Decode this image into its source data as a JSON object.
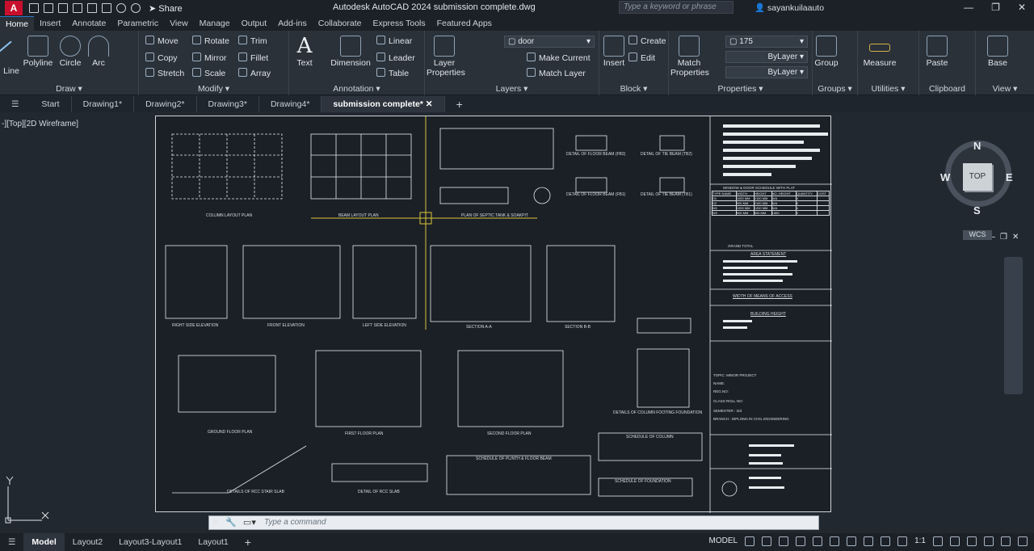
{
  "app": {
    "logo_letter": "A",
    "share_label": "Share",
    "window_title": "Autodesk AutoCAD 2024   submission complete.dwg",
    "search_placeholder": "Type a keyword or phrase",
    "user_name": "sayankuilaauto"
  },
  "ribbon_tabs": [
    "Home",
    "Insert",
    "Annotate",
    "Parametric",
    "View",
    "Manage",
    "Output",
    "Add-ins",
    "Collaborate",
    "Express Tools",
    "Featured Apps"
  ],
  "ribbon": {
    "draw": {
      "title": "Draw ▾",
      "line": "Line",
      "polyline": "Polyline",
      "circle": "Circle",
      "arc": "Arc"
    },
    "modify": {
      "title": "Modify ▾",
      "move": "Move",
      "rotate": "Rotate",
      "trim": "Trim",
      "copy": "Copy",
      "mirror": "Mirror",
      "fillet": "Fillet",
      "stretch": "Stretch",
      "scale": "Scale",
      "array": "Array"
    },
    "annotation": {
      "title": "Annotation ▾",
      "text": "Text",
      "dimension": "Dimension",
      "linear": "Linear",
      "leader": "Leader",
      "table": "Table"
    },
    "layers": {
      "title": "Layers ▾",
      "layer_properties": "Layer Properties",
      "current_layer": "door",
      "make_current": "Make Current",
      "match_layer": "Match Layer"
    },
    "block": {
      "title": "Block ▾",
      "insert": "Insert",
      "create": "Create",
      "edit": "Edit"
    },
    "properties": {
      "title": "Properties ▾",
      "match_properties": "Match Properties",
      "color": "175",
      "linetype": "ByLayer",
      "lineweight": "ByLayer"
    },
    "groups": {
      "title": "Groups ▾",
      "group": "Group"
    },
    "utilities": {
      "title": "Utilities ▾",
      "measure": "Measure"
    },
    "clipboard": {
      "title": "Clipboard",
      "paste": "Paste"
    },
    "view": {
      "title": "View ▾",
      "base": "Base"
    }
  },
  "file_tabs": [
    "Start",
    "Drawing1*",
    "Drawing2*",
    "Drawing3*",
    "Drawing4*",
    "submission complete*"
  ],
  "viewport": {
    "label": "-][Top][2D Wireframe]",
    "compass": {
      "n": "N",
      "s": "S",
      "e": "E",
      "w": "W",
      "top": "TOP",
      "wcs": "WCS"
    }
  },
  "drawing_labels": {
    "column_layout": "COLUMN LAYOUT PLAN",
    "beam_layout": "BEAM LAYOUT PLAN",
    "septic_tank": "PLAN OF SEPTIC TANK & SOAKPIT",
    "floor_beam_fb2": "DETAIL OF FLOOR BEAM (FB2)",
    "tie_beam_tb2": "DETAIL OF TIE BEAM (TB2)",
    "floor_beam_fb1": "DETAIL OF FLOOR BEAM (FB1)",
    "tie_beam_tb1": "DETAIL OF TIE BEAM (TB1)",
    "right_side": "RIGHT SIDE ELEVATION",
    "front": "FRONT ELEVATION",
    "left_side": "LEFT SIDE ELEVATION",
    "section_aa": "SECTION A-A",
    "section_bb": "SECTION B-B",
    "ground_floor": "GROUND FLOOR PLAN",
    "first_floor": "FIRST FLOOR PLAN",
    "second_floor": "SECOND FLOOR PLAN",
    "column_footing": "DETAILS OF COLUMN FOOTING FOUNDATION",
    "stair_slab": "DETAILS OF RCC STAIR SLAB",
    "rcc_slab": "DETAIL OF RCC SLAB",
    "schedule_column": "SCHEDULE OF COLUMN",
    "schedule_plinth": "SCHEDULE OF PLINTH & FLOOR BEAM",
    "schedule_foundation": "SCHEDULE OF FOUNDATION",
    "window_door": "WINDOW & DOOR SCHEDULE WITH FLAT",
    "grand_total": "GRAND TOTAL",
    "area_statement": "AREA STATEMENT",
    "means_of_access": "WIDTH OF MEANS OF ACCESS",
    "building_height": "BUILDING HEIGHT",
    "topic": "TOPIC: MINOR PROJECT",
    "name": "NAME:",
    "reg_no": "REG.NO:",
    "class_roll": "CLASS ROLL NO:",
    "semester": "SEMESTER : 3rd",
    "branch": "BRANCH : DIPLOMA IN CIVIL ENGINEERING"
  },
  "window_table": {
    "headers": [
      "TYPE NAME",
      "WIDTH",
      "HEIGHT",
      "NO. HEIGHT",
      "QUANTITY",
      "COST"
    ],
    "rows": [
      [
        "D1",
        "1000 MM",
        "2100 MM",
        "N/A",
        "4",
        ""
      ],
      [
        "D2",
        "900 MM",
        "2100 MM",
        "N/A",
        "6",
        ""
      ],
      [
        "W1",
        "1200 MM",
        "1200 MM",
        "N/A",
        "4",
        ""
      ],
      [
        "W2",
        "900 MM",
        "900 MM",
        "1500",
        "3",
        ""
      ]
    ]
  },
  "command_placeholder": "Type a command",
  "layout_tabs": [
    "Model",
    "Layout2",
    "Layout3-Layout1",
    "Layout1"
  ],
  "status": {
    "model": "MODEL",
    "scale": "1:1"
  }
}
